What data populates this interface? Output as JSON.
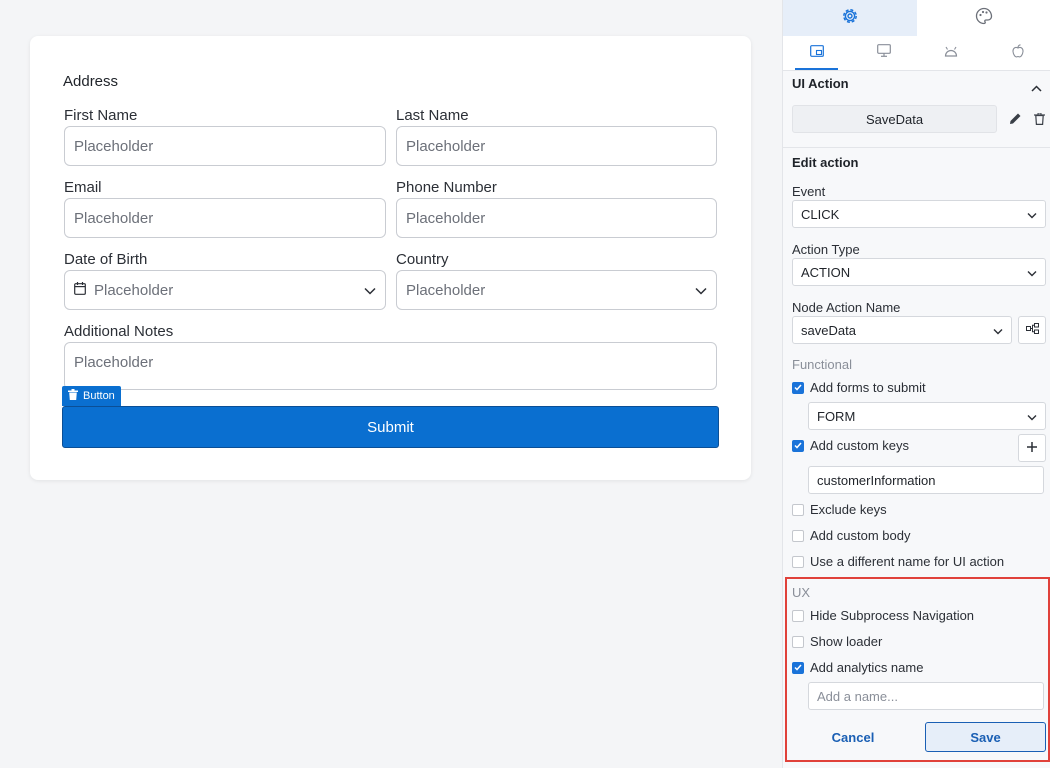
{
  "form": {
    "title": "Address",
    "fields": {
      "first_name": {
        "label": "First Name",
        "placeholder": "Placeholder"
      },
      "last_name": {
        "label": "Last Name",
        "placeholder": "Placeholder"
      },
      "email": {
        "label": "Email",
        "placeholder": "Placeholder"
      },
      "phone": {
        "label": "Phone Number",
        "placeholder": "Placeholder"
      },
      "dob": {
        "label": "Date of Birth",
        "placeholder": "Placeholder"
      },
      "country": {
        "label": "Country",
        "placeholder": "Placeholder"
      },
      "notes": {
        "label": "Additional Notes",
        "placeholder": "Placeholder"
      }
    },
    "button_tag": "Button",
    "submit_label": "Submit"
  },
  "panel": {
    "ui_action_title": "UI Action",
    "action_name": "SaveData",
    "edit_action_title": "Edit action",
    "event": {
      "label": "Event",
      "value": "CLICK"
    },
    "action_type": {
      "label": "Action Type",
      "value": "ACTION"
    },
    "node_action": {
      "label": "Node Action Name",
      "value": "saveData"
    },
    "functional": {
      "title": "Functional",
      "add_forms": {
        "label": "Add forms to submit",
        "checked": true,
        "value": "FORM"
      },
      "custom_keys": {
        "label": "Add custom keys",
        "checked": true,
        "value": "customerInformation"
      },
      "exclude_keys": {
        "label": "Exclude keys",
        "checked": false
      },
      "custom_body": {
        "label": "Add custom body",
        "checked": false
      },
      "different_name": {
        "label": "Use a different name for UI action",
        "checked": false
      }
    },
    "ux": {
      "title": "UX",
      "hide_subprocess": {
        "label": "Hide Subprocess Navigation",
        "checked": false
      },
      "show_loader": {
        "label": "Show loader",
        "checked": false
      },
      "analytics": {
        "label": "Add analytics name",
        "checked": true,
        "placeholder": "Add a name..."
      }
    },
    "cancel_label": "Cancel",
    "save_label": "Save"
  },
  "colors": {
    "primary": "#0a6fd0",
    "accent": "#1a73d9",
    "highlight_border": "#e0413a"
  },
  "icons": [
    "gear-icon",
    "palette-icon",
    "web-layout-icon",
    "desktop-icon",
    "android-icon",
    "apple-icon",
    "chevron-up-icon",
    "chevron-down-icon",
    "pencil-icon",
    "trash-icon",
    "flow-icon",
    "plus-icon",
    "calendar-icon",
    "check-icon"
  ]
}
